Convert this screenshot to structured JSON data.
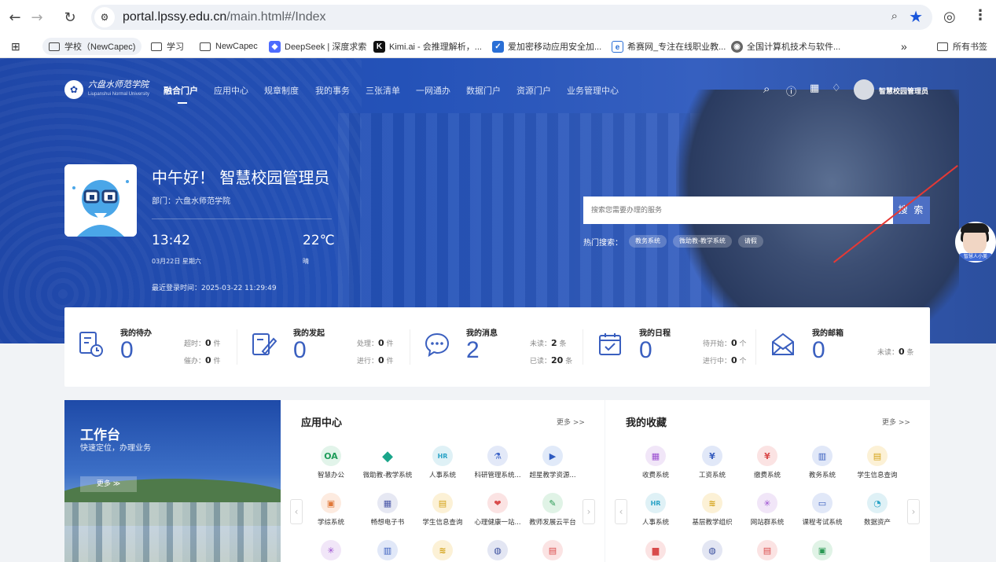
{
  "browser": {
    "url_host": "portal.lpssy.edu.cn",
    "url_path": "/main.html#/Index",
    "bookmarks": [
      {
        "label": "学校（NewCapec)"
      },
      {
        "label": "学习"
      },
      {
        "label": "NewCapec"
      },
      {
        "label": "DeepSeek | 深度求索"
      },
      {
        "label": "Kimi.ai - 会推理解析，..."
      },
      {
        "label": "爱加密移动应用安全加..."
      },
      {
        "label": "希赛网_专注在线职业教..."
      },
      {
        "label": "全国计算机技术与软件..."
      }
    ],
    "overflow": "»",
    "all_bookmarks": "所有书签"
  },
  "colors": {
    "brand": "#1f47a8",
    "accent": "#3a5fbf",
    "star": "#1a56db",
    "annotation": "#e53935"
  },
  "header": {
    "logo_text": "六盘水师范学院",
    "logo_sub": "Liupanshui Normal University",
    "nav": [
      "融合门户",
      "应用中心",
      "规章制度",
      "我的事务",
      "三张清单",
      "一网通办",
      "数据门户",
      "资源门户",
      "业务管理中心"
    ],
    "username": "智慧校园管理员"
  },
  "profile": {
    "greeting": "中午好！ 智慧校园管理员",
    "dept": "部门：六盘水师范学院",
    "time": "13:42",
    "temp": "22℃",
    "date": "03月22日 星期六",
    "weather": "晴",
    "last_login": "最近登录时间：2025-03-22 11:29:49"
  },
  "search": {
    "placeholder": "搜索您需要办理的服务",
    "button": "搜 索",
    "hot_label": "热门搜索：",
    "hot_tags": [
      "教务系统",
      "微助教-教学系统",
      "请假"
    ]
  },
  "stats": [
    {
      "title": "我的待办",
      "num": "0",
      "r1_label": "超时：",
      "r1_val": "0",
      "r1_unit": "件",
      "r2_label": "催办：",
      "r2_val": "0",
      "r2_unit": "件"
    },
    {
      "title": "我的发起",
      "num": "0",
      "r1_label": "处理：",
      "r1_val": "0",
      "r1_unit": "件",
      "r2_label": "进行：",
      "r2_val": "0",
      "r2_unit": "件"
    },
    {
      "title": "我的消息",
      "num": "2",
      "r1_label": "未读：",
      "r1_val": "2",
      "r1_unit": "条",
      "r2_label": "已读：",
      "r2_val": "20",
      "r2_unit": "条"
    },
    {
      "title": "我的日程",
      "num": "0",
      "r1_label": "待开始：",
      "r1_val": "0",
      "r1_unit": "个",
      "r2_label": "进行中：",
      "r2_val": "0",
      "r2_unit": "个"
    },
    {
      "title": "我的邮箱",
      "num": "0",
      "r1_label": "未读：",
      "r1_val": "0",
      "r1_unit": "条"
    }
  ],
  "workbench": {
    "title": "工作台",
    "subtitle": "快速定位，办理业务",
    "more": "更多 ≫"
  },
  "app_center": {
    "title": "应用中心",
    "more": "更多 >>",
    "apps": [
      "智慧办公",
      "微助教-教学系统",
      "人事系统",
      "科研管理系统...",
      "超星教学资源...",
      "学综系统",
      "畅想电子书",
      "学生信息查询",
      "心理健康一站...",
      "教师发展云平台"
    ]
  },
  "favorites": {
    "title": "我的收藏",
    "more": "更多 >>",
    "apps": [
      "收费系统",
      "工资系统",
      "缴费系统",
      "教务系统",
      "学生信息查询",
      "人事系统",
      "基层教学组织",
      "网站群系统",
      "课程考试系统",
      "数据资产"
    ]
  },
  "assistant": {
    "label": "智慧人小美"
  }
}
